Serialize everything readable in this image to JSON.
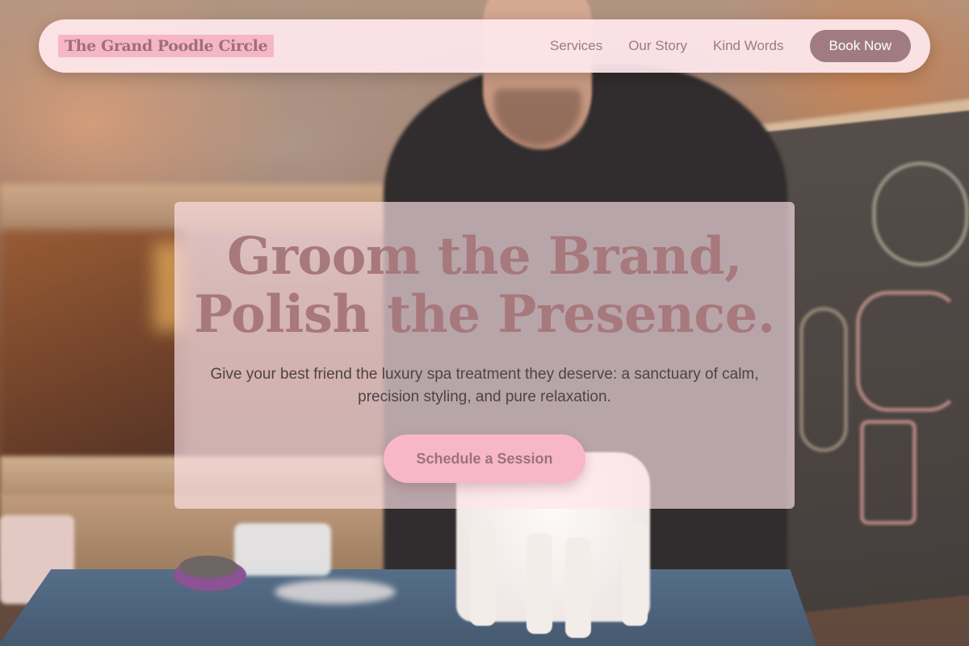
{
  "nav": {
    "brand": "The Grand Poodle Circle",
    "links": [
      "Services",
      "Our Story",
      "Kind Words"
    ],
    "cta": "Book Now"
  },
  "hero": {
    "title_line1": "Groom the Brand,",
    "title_line2": "Polish the Presence.",
    "subtitle": "Give your best friend the luxury spa treatment they deserve: a sanctuary of calm, precision styling, and pure relaxation.",
    "cta": "Schedule a Session"
  },
  "colors": {
    "brand_bg": "#f5b7c6",
    "accent": "#a07c81",
    "title": "#a7787c",
    "cta_bg": "#f8b7c7"
  }
}
